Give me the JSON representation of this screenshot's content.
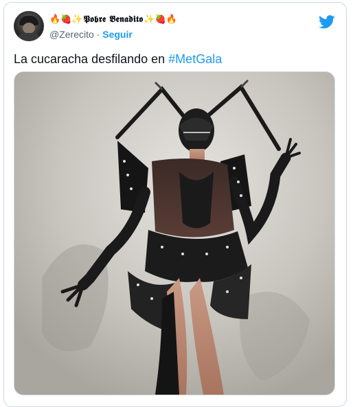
{
  "tweet": {
    "author": {
      "display_name": "𝕻𝖔𝖇𝖗𝖊 𝕭𝖊𝖓𝖆𝖉𝖎𝖙𝖔",
      "emoji_prefix": "🔥🍓✨",
      "emoji_suffix": "✨🍓🔥",
      "handle": "@Zerecito",
      "separator": " · ",
      "follow_label": "Seguir"
    },
    "text_before": "La cucaracha desfilando en ",
    "hashtag": "#MetGala",
    "brand_icon": "twitter-bird-icon",
    "colors": {
      "accent": "#1d9bf0",
      "text": "#0f1419",
      "secondary": "#536471",
      "border": "#cfd9de"
    }
  }
}
